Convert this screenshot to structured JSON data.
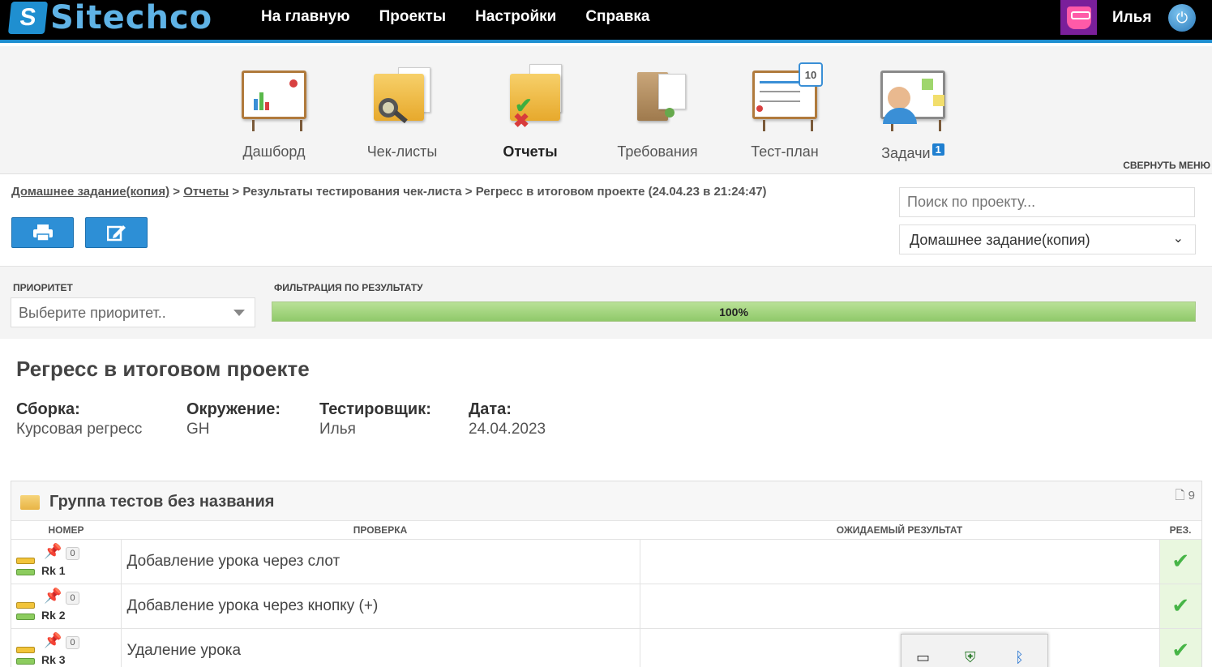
{
  "header": {
    "logo_text": "Sitechco",
    "nav": [
      {
        "label": "На главную"
      },
      {
        "label": "Проекты"
      },
      {
        "label": "Настройки"
      },
      {
        "label": "Справка"
      }
    ],
    "user_name": "Илья"
  },
  "modules": {
    "items": [
      {
        "label": "Дашборд",
        "icon": "dashboard-icon"
      },
      {
        "label": "Чек-листы",
        "icon": "checklists-icon"
      },
      {
        "label": "Отчеты",
        "icon": "reports-icon",
        "active": true
      },
      {
        "label": "Требования",
        "icon": "requirements-icon"
      },
      {
        "label": "Тест-план",
        "icon": "testplan-icon",
        "calendar_day": "10"
      },
      {
        "label": "Задачи",
        "icon": "tasks-icon",
        "badge": "1"
      }
    ],
    "collapse_label": "СВЕРНУТЬ МЕНЮ"
  },
  "breadcrumb": {
    "project": "Домашнее задание(копия)",
    "sep": ">",
    "reports": "Отчеты",
    "results": "Результаты тестирования чек-листа",
    "current": "Регресс в итоговом проекте (24.04.23 в 21:24:47)"
  },
  "search": {
    "placeholder": "Поиск по проекту..."
  },
  "project_select": {
    "value": "Домашнее задание(копия)"
  },
  "filters": {
    "priority_label": "ПРИОРИТЕТ",
    "priority_placeholder": "Выберите приоритет..",
    "result_label": "ФИЛЬТРАЦИЯ ПО РЕЗУЛЬТАТУ",
    "progress_text": "100%",
    "progress_fraction": 1.0
  },
  "report": {
    "title": "Регресс в итоговом проекте",
    "meta": [
      {
        "label": "Сборка:",
        "value": "Курсовая регресс"
      },
      {
        "label": "Окружение:",
        "value": "GH"
      },
      {
        "label": "Тестировщик:",
        "value": "Илья"
      },
      {
        "label": "Дата:",
        "value": "24.04.2023"
      }
    ]
  },
  "group": {
    "title": "Группа тестов без названия",
    "count": "9",
    "columns": [
      "НОМЕР",
      "ПРОВЕРКА",
      "ОЖИДАЕМЫЙ РЕЗУЛЬТАТ",
      "РЕЗ."
    ],
    "rows": [
      {
        "num": "Rk 1",
        "comments": "0",
        "check": "Добавление урока через слот",
        "expected": "",
        "result": "passed"
      },
      {
        "num": "Rk 2",
        "comments": "0",
        "check": "Добавление урока через кнопку (+)",
        "expected": "",
        "result": "passed"
      },
      {
        "num": "Rk 3",
        "comments": "0",
        "check": "Удаление урока",
        "expected": "",
        "result": "passed"
      }
    ]
  },
  "colors": {
    "brand": "#1f8fd0",
    "passed": "#47b547",
    "progress": "#90c96a"
  }
}
